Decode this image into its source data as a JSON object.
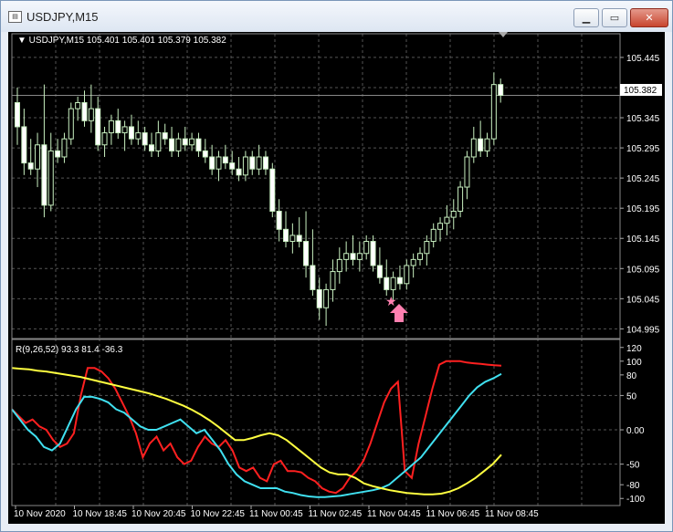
{
  "window": {
    "title": "USDJPY,M15",
    "icon": "chart-window-icon",
    "buttons": {
      "minimize": "▁",
      "restore": "▭",
      "close": "✕"
    }
  },
  "price_panel": {
    "header": "▼  USDJPY,M15  105.401 105.401 105.379 105.382",
    "current_price": "105.382",
    "y_ticks": [
      "105.445",
      "105.395",
      "105.345",
      "105.295",
      "105.245",
      "105.195",
      "105.145",
      "105.095",
      "105.045",
      "104.995"
    ]
  },
  "indicator_panel": {
    "header": "R(9,26,52) 93.3 81.4 -36.3",
    "y_ticks": [
      "120",
      "100",
      "80",
      "50",
      "0.00",
      "-50",
      "-80",
      "-100"
    ]
  },
  "time_axis": [
    "10 Nov 2020",
    "10 Nov 18:45",
    "10 Nov 20:45",
    "10 Nov 22:45",
    "11 Nov 00:45",
    "11 Nov 02:45",
    "11 Nov 04:45",
    "11 Nov 06:45",
    "11 Nov 08:45"
  ],
  "colors": {
    "background": "#000000",
    "grid": "#555555",
    "bull": "#c8f0c0",
    "bear": "#ffffff",
    "red": "#ff2020",
    "cyan": "#40e0f0",
    "yellow": "#ffff40",
    "marker": "#ff80b0"
  },
  "chart_data": {
    "type": "candlestick",
    "symbol": "USDJPY",
    "timeframe": "M15",
    "ylim": [
      104.985,
      105.46
    ],
    "candles": [
      {
        "o": 105.37,
        "h": 105.395,
        "l": 105.3,
        "c": 105.33
      },
      {
        "o": 105.33,
        "h": 105.36,
        "l": 105.25,
        "c": 105.27
      },
      {
        "o": 105.27,
        "h": 105.31,
        "l": 105.25,
        "c": 105.26
      },
      {
        "o": 105.26,
        "h": 105.32,
        "l": 105.23,
        "c": 105.3
      },
      {
        "o": 105.3,
        "h": 105.4,
        "l": 105.18,
        "c": 105.2
      },
      {
        "o": 105.2,
        "h": 105.32,
        "l": 105.19,
        "c": 105.29
      },
      {
        "o": 105.29,
        "h": 105.31,
        "l": 105.27,
        "c": 105.28
      },
      {
        "o": 105.28,
        "h": 105.32,
        "l": 105.27,
        "c": 105.31
      },
      {
        "o": 105.31,
        "h": 105.37,
        "l": 105.3,
        "c": 105.36
      },
      {
        "o": 105.36,
        "h": 105.38,
        "l": 105.34,
        "c": 105.37
      },
      {
        "o": 105.37,
        "h": 105.39,
        "l": 105.33,
        "c": 105.34
      },
      {
        "o": 105.34,
        "h": 105.4,
        "l": 105.32,
        "c": 105.36
      },
      {
        "o": 105.36,
        "h": 105.38,
        "l": 105.29,
        "c": 105.3
      },
      {
        "o": 105.3,
        "h": 105.33,
        "l": 105.28,
        "c": 105.32
      },
      {
        "o": 105.32,
        "h": 105.35,
        "l": 105.3,
        "c": 105.34
      },
      {
        "o": 105.34,
        "h": 105.36,
        "l": 105.31,
        "c": 105.32
      },
      {
        "o": 105.32,
        "h": 105.34,
        "l": 105.29,
        "c": 105.33
      },
      {
        "o": 105.33,
        "h": 105.35,
        "l": 105.3,
        "c": 105.31
      },
      {
        "o": 105.31,
        "h": 105.34,
        "l": 105.3,
        "c": 105.32
      },
      {
        "o": 105.32,
        "h": 105.33,
        "l": 105.29,
        "c": 105.3
      },
      {
        "o": 105.3,
        "h": 105.32,
        "l": 105.28,
        "c": 105.29
      },
      {
        "o": 105.29,
        "h": 105.34,
        "l": 105.28,
        "c": 105.32
      },
      {
        "o": 105.32,
        "h": 105.335,
        "l": 105.3,
        "c": 105.31
      },
      {
        "o": 105.31,
        "h": 105.33,
        "l": 105.28,
        "c": 105.29
      },
      {
        "o": 105.29,
        "h": 105.32,
        "l": 105.28,
        "c": 105.31
      },
      {
        "o": 105.31,
        "h": 105.33,
        "l": 105.29,
        "c": 105.3
      },
      {
        "o": 105.3,
        "h": 105.32,
        "l": 105.29,
        "c": 105.31
      },
      {
        "o": 105.31,
        "h": 105.32,
        "l": 105.28,
        "c": 105.29
      },
      {
        "o": 105.29,
        "h": 105.31,
        "l": 105.27,
        "c": 105.28
      },
      {
        "o": 105.28,
        "h": 105.3,
        "l": 105.25,
        "c": 105.26
      },
      {
        "o": 105.26,
        "h": 105.29,
        "l": 105.24,
        "c": 105.28
      },
      {
        "o": 105.28,
        "h": 105.3,
        "l": 105.26,
        "c": 105.27
      },
      {
        "o": 105.27,
        "h": 105.29,
        "l": 105.25,
        "c": 105.26
      },
      {
        "o": 105.26,
        "h": 105.28,
        "l": 105.24,
        "c": 105.25
      },
      {
        "o": 105.25,
        "h": 105.29,
        "l": 105.24,
        "c": 105.28
      },
      {
        "o": 105.28,
        "h": 105.29,
        "l": 105.25,
        "c": 105.26
      },
      {
        "o": 105.26,
        "h": 105.3,
        "l": 105.25,
        "c": 105.28
      },
      {
        "o": 105.28,
        "h": 105.29,
        "l": 105.25,
        "c": 105.26
      },
      {
        "o": 105.26,
        "h": 105.27,
        "l": 105.18,
        "c": 105.19
      },
      {
        "o": 105.19,
        "h": 105.21,
        "l": 105.14,
        "c": 105.16
      },
      {
        "o": 105.16,
        "h": 105.19,
        "l": 105.13,
        "c": 105.14
      },
      {
        "o": 105.14,
        "h": 105.17,
        "l": 105.12,
        "c": 105.15
      },
      {
        "o": 105.15,
        "h": 105.18,
        "l": 105.13,
        "c": 105.14
      },
      {
        "o": 105.14,
        "h": 105.19,
        "l": 105.08,
        "c": 105.1
      },
      {
        "o": 105.1,
        "h": 105.16,
        "l": 105.05,
        "c": 105.06
      },
      {
        "o": 105.06,
        "h": 105.08,
        "l": 105.01,
        "c": 105.03
      },
      {
        "o": 105.03,
        "h": 105.07,
        "l": 105.0,
        "c": 105.06
      },
      {
        "o": 105.06,
        "h": 105.11,
        "l": 105.04,
        "c": 105.09
      },
      {
        "o": 105.09,
        "h": 105.13,
        "l": 105.07,
        "c": 105.11
      },
      {
        "o": 105.11,
        "h": 105.14,
        "l": 105.09,
        "c": 105.12
      },
      {
        "o": 105.12,
        "h": 105.15,
        "l": 105.1,
        "c": 105.11
      },
      {
        "o": 105.11,
        "h": 105.14,
        "l": 105.09,
        "c": 105.12
      },
      {
        "o": 105.12,
        "h": 105.15,
        "l": 105.11,
        "c": 105.14
      },
      {
        "o": 105.14,
        "h": 105.15,
        "l": 105.09,
        "c": 105.1
      },
      {
        "o": 105.1,
        "h": 105.13,
        "l": 105.07,
        "c": 105.08
      },
      {
        "o": 105.08,
        "h": 105.11,
        "l": 105.05,
        "c": 105.06
      },
      {
        "o": 105.06,
        "h": 105.09,
        "l": 105.04,
        "c": 105.08
      },
      {
        "o": 105.08,
        "h": 105.1,
        "l": 105.06,
        "c": 105.07
      },
      {
        "o": 105.07,
        "h": 105.11,
        "l": 105.06,
        "c": 105.1
      },
      {
        "o": 105.1,
        "h": 105.12,
        "l": 105.08,
        "c": 105.11
      },
      {
        "o": 105.11,
        "h": 105.13,
        "l": 105.1,
        "c": 105.12
      },
      {
        "o": 105.12,
        "h": 105.15,
        "l": 105.1,
        "c": 105.14
      },
      {
        "o": 105.14,
        "h": 105.17,
        "l": 105.13,
        "c": 105.16
      },
      {
        "o": 105.16,
        "h": 105.18,
        "l": 105.14,
        "c": 105.17
      },
      {
        "o": 105.17,
        "h": 105.2,
        "l": 105.15,
        "c": 105.18
      },
      {
        "o": 105.18,
        "h": 105.21,
        "l": 105.16,
        "c": 105.19
      },
      {
        "o": 105.19,
        "h": 105.24,
        "l": 105.18,
        "c": 105.23
      },
      {
        "o": 105.23,
        "h": 105.29,
        "l": 105.21,
        "c": 105.28
      },
      {
        "o": 105.28,
        "h": 105.33,
        "l": 105.27,
        "c": 105.31
      },
      {
        "o": 105.31,
        "h": 105.34,
        "l": 105.28,
        "c": 105.29
      },
      {
        "o": 105.29,
        "h": 105.32,
        "l": 105.28,
        "c": 105.31
      },
      {
        "o": 105.31,
        "h": 105.42,
        "l": 105.3,
        "c": 105.4
      },
      {
        "o": 105.4,
        "h": 105.41,
        "l": 105.37,
        "c": 105.382
      }
    ],
    "oscillator": {
      "name": "R(9,26,52)",
      "ylim": [
        -105,
        125
      ],
      "series": [
        {
          "values": [
            30,
            20,
            10,
            15,
            5,
            0,
            -15,
            -25,
            -20,
            -5,
            50,
            90,
            90,
            85,
            75,
            60,
            40,
            20,
            -5,
            -40,
            -20,
            -10,
            -30,
            -20,
            -40,
            -50,
            -45,
            -25,
            -10,
            -20,
            -25,
            -15,
            -30,
            -55,
            -60,
            -55,
            -70,
            -75,
            -50,
            -45,
            -60,
            -60,
            -62,
            -70,
            -75,
            -85,
            -90,
            -92,
            -85,
            -70,
            -60,
            -45,
            -20,
            10,
            40,
            60,
            70,
            -60,
            -70,
            -20,
            20,
            60,
            95,
            100,
            100,
            100,
            98,
            97,
            96,
            95,
            94,
            93.3
          ]
        },
        {
          "values": [
            30,
            15,
            0,
            -10,
            -25,
            -30,
            -20,
            5,
            30,
            48,
            48,
            45,
            40,
            30,
            25,
            15,
            5,
            0,
            0,
            5,
            10,
            15,
            5,
            -5,
            0,
            -15,
            -30,
            -50,
            -65,
            -75,
            -80,
            -85,
            -85,
            -85,
            -90,
            -92,
            -95,
            -97,
            -98,
            -98,
            -97,
            -96,
            -94,
            -92,
            -90,
            -88,
            -85,
            -80,
            -70,
            -60,
            -50,
            -40,
            -25,
            -10,
            5,
            20,
            35,
            50,
            62,
            70,
            75,
            81.4
          ]
        },
        {
          "values": [
            90,
            89,
            88,
            86,
            85,
            83,
            81,
            79,
            77,
            74,
            71,
            68,
            65,
            62,
            59,
            56,
            53,
            49,
            45,
            40,
            35,
            29,
            22,
            14,
            5,
            -5,
            -15,
            -15,
            -12,
            -8,
            -5,
            -8,
            -15,
            -25,
            -35,
            -45,
            -55,
            -62,
            -65,
            -65,
            -70,
            -78,
            -82,
            -85,
            -88,
            -90,
            -92,
            -93,
            -94,
            -94,
            -93,
            -90,
            -85,
            -78,
            -70,
            -60,
            -50,
            -36.3
          ]
        }
      ]
    }
  }
}
